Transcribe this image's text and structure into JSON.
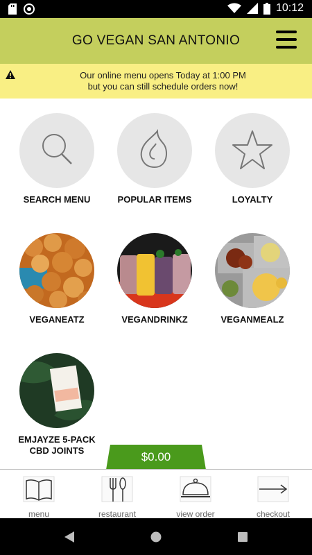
{
  "status_bar": {
    "time": "10:12"
  },
  "header": {
    "title": "GO VEGAN SAN ANTONIO"
  },
  "notice": {
    "line1": "Our online menu opens Today at 1:00 PM",
    "line2": "but you can still schedule orders now!"
  },
  "tiles": [
    {
      "label": "SEARCH MENU",
      "icon": "search-icon"
    },
    {
      "label": "POPULAR ITEMS",
      "icon": "flame-icon"
    },
    {
      "label": "LOYALTY",
      "icon": "star-icon"
    },
    {
      "label": "VEGANEATZ",
      "image": "fried nuggets"
    },
    {
      "label": "VEGANDRINKZ",
      "image": "smoothies"
    },
    {
      "label": "VEGANMEALZ",
      "image": "meal trays"
    },
    {
      "label_line1": "EMJAYZE 5-PACK",
      "label_line2": "CBD JOINTS",
      "image": "cbd package"
    }
  ],
  "cart": {
    "total": "$0.00"
  },
  "bottom_nav": [
    {
      "label": "menu",
      "icon": "book-icon"
    },
    {
      "label": "restaurant",
      "icon": "cutlery-icon"
    },
    {
      "label": "view order",
      "icon": "cloche-icon"
    },
    {
      "label": "checkout",
      "icon": "arrow-right-icon"
    }
  ],
  "colors": {
    "header": "#c4cf5d",
    "notice": "#f9ef84",
    "cart": "#4a9a1c"
  }
}
